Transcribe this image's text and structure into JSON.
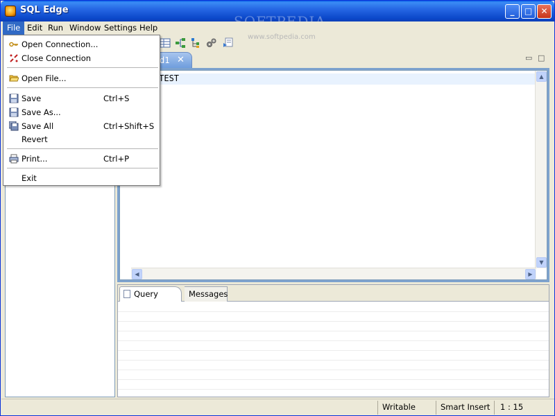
{
  "window": {
    "title": "SQL Edge",
    "watermark": "SOFTPEDIA",
    "watermark_url": "www.softpedia.com"
  },
  "menubar": {
    "items": [
      {
        "label": "File",
        "active": true
      },
      {
        "label": "Edit"
      },
      {
        "label": "Run"
      },
      {
        "label": "Window"
      },
      {
        "label": "Settings"
      },
      {
        "label": "Help"
      }
    ]
  },
  "file_menu": {
    "items": [
      {
        "label": "Open Connection...",
        "shortcut": "",
        "icon": "key-connect-icon"
      },
      {
        "label": "Close Connection",
        "shortcut": "",
        "icon": "disconnect-icon"
      },
      {
        "label": "Open File...",
        "shortcut": "",
        "icon": "folder-open-icon"
      },
      {
        "label": "Save",
        "shortcut": "Ctrl+S",
        "icon": "floppy-disk-icon"
      },
      {
        "label": "Save As...",
        "shortcut": "",
        "icon": "floppy-disk-as-icon"
      },
      {
        "label": "Save All",
        "shortcut": "Ctrl+Shift+S",
        "icon": "floppy-disk-multi-icon"
      },
      {
        "label": "Revert",
        "shortcut": "",
        "icon": ""
      },
      {
        "label": "Print...",
        "shortcut": "Ctrl+P",
        "icon": "printer-icon"
      },
      {
        "label": "Exit",
        "shortcut": "",
        "icon": ""
      }
    ]
  },
  "editor": {
    "tab_label": "d1",
    "content": "edia TEST"
  },
  "result_panel": {
    "tabs": [
      {
        "label": "Query Result",
        "active": true
      },
      {
        "label": "Messages",
        "active": false
      }
    ]
  },
  "statusbar": {
    "mode": "Writable",
    "insert": "Smart Insert",
    "position": "1 : 15"
  },
  "colors": {
    "accent": "#316ac5",
    "titlebar": "#0b47c9",
    "editor_frame": "#7da2ce"
  }
}
